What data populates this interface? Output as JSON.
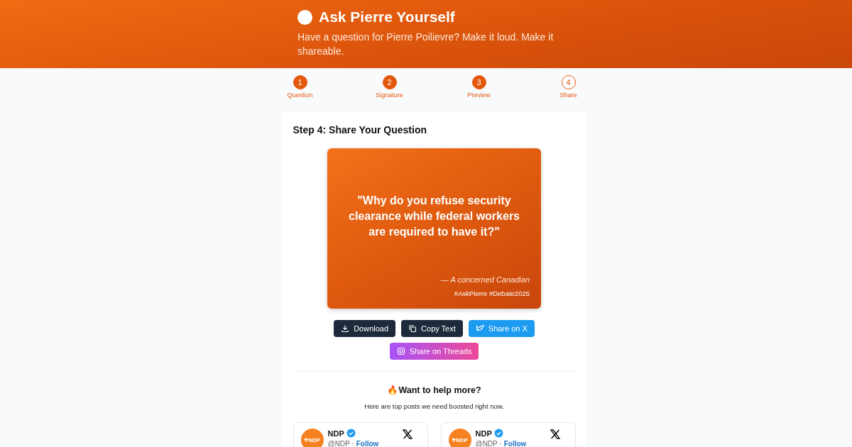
{
  "header": {
    "title": "Ask Pierre Yourself",
    "subtitle": "Have a question for Pierre Poilievre? Make it loud. Make it shareable."
  },
  "steps": [
    {
      "number": "1",
      "label": "Question",
      "completed": true
    },
    {
      "number": "2",
      "label": "Signature",
      "completed": true
    },
    {
      "number": "3",
      "label": "Preview",
      "completed": true
    },
    {
      "number": "4",
      "label": "Share",
      "completed": false
    }
  ],
  "card": {
    "heading": "Step 4: Share Your Question",
    "preview": {
      "question": "\"Why do you refuse security clearance while federal workers are required to have it?\"",
      "signature": "— A concerned Canadian",
      "hashtags": "#AskPierre #Debate2025"
    },
    "buttons": [
      {
        "kind": "download",
        "label": "Download"
      },
      {
        "kind": "copy",
        "label": "Copy Text"
      },
      {
        "kind": "x",
        "label": "Share on X"
      },
      {
        "kind": "threads",
        "label": "Share on Threads"
      }
    ],
    "help": {
      "emoji": "🔥",
      "title": "Want to help more?",
      "text": "Here are top posts we need boosted right now."
    },
    "posts": [
      {
        "avatar": "NDP",
        "name": "NDP",
        "handle": "@NDP ·",
        "follow": "Follow"
      },
      {
        "avatar": "NDP",
        "name": "NDP",
        "handle": "@NDP ·",
        "follow": "Follow"
      }
    ]
  }
}
